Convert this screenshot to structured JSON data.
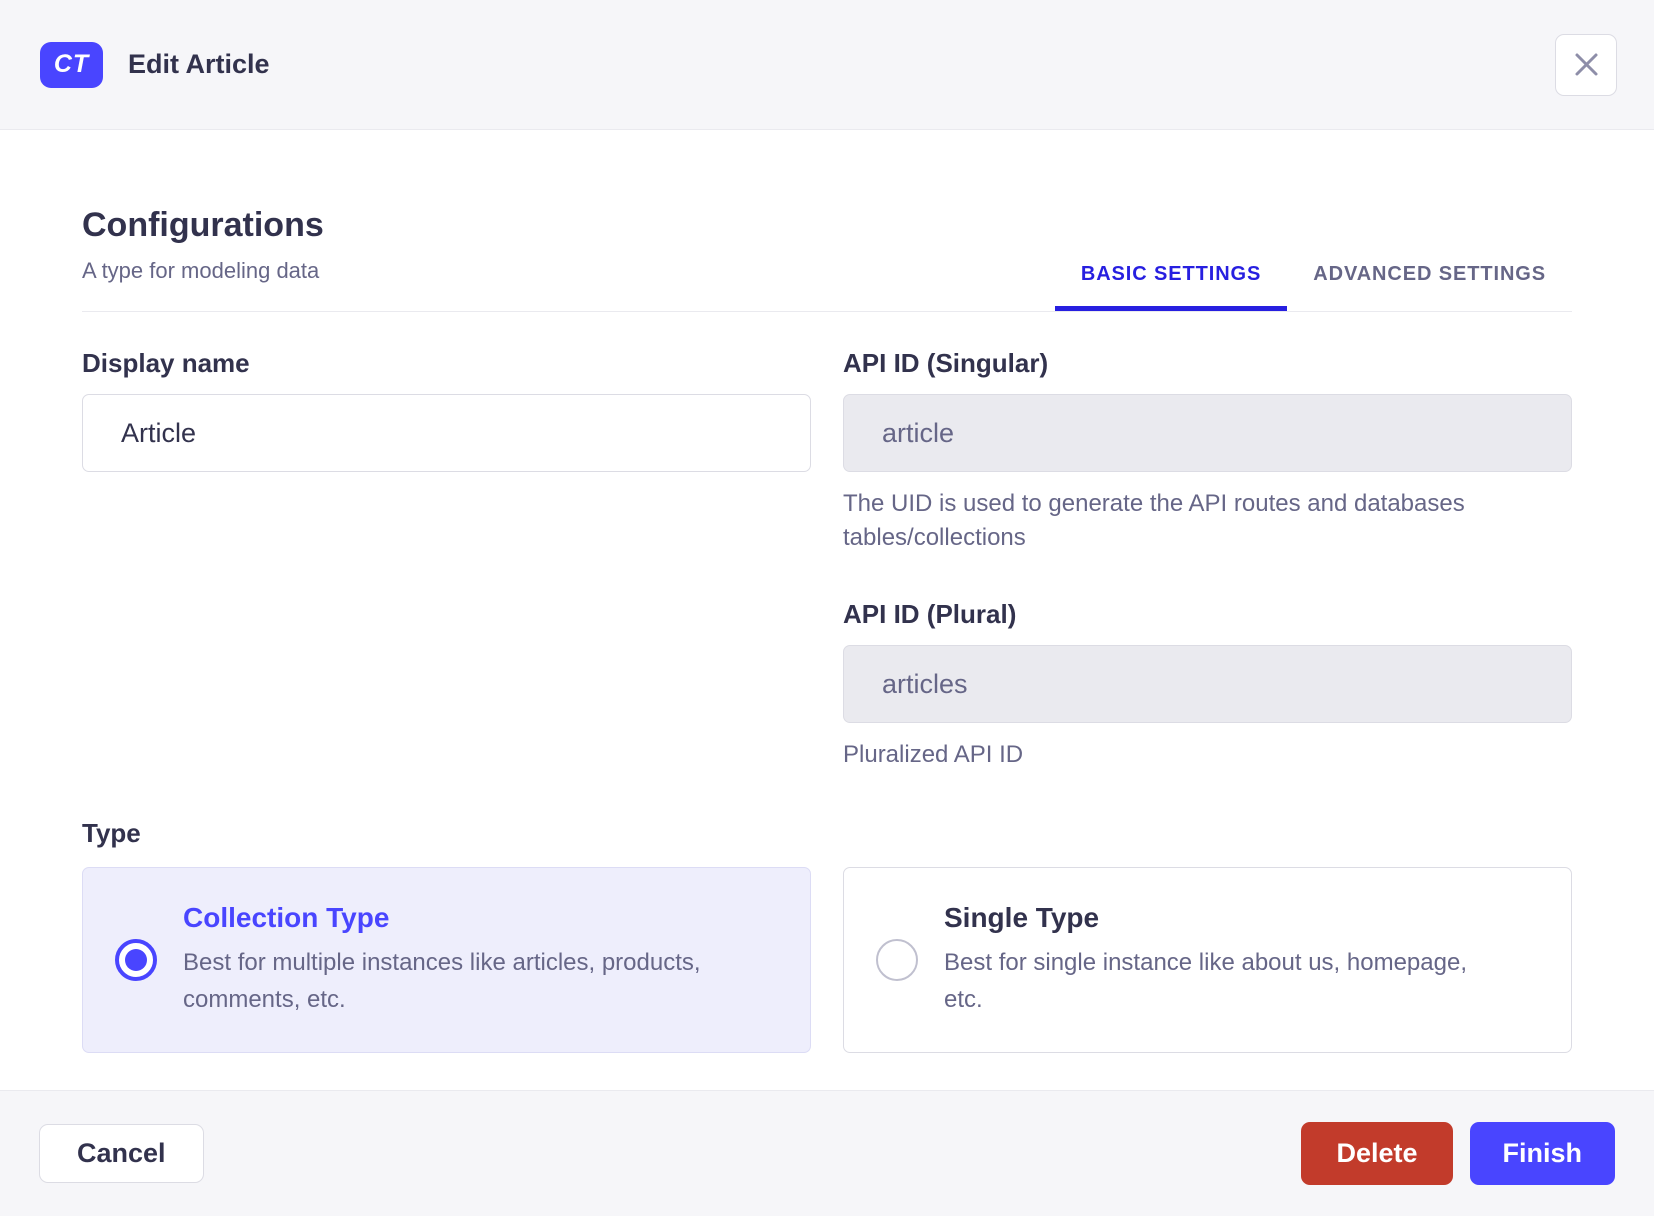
{
  "header": {
    "badge": "CT",
    "title": "Edit Article"
  },
  "icons": {
    "close": "x-mark"
  },
  "section": {
    "title": "Configurations",
    "subtitle": "A type for modeling data"
  },
  "tabs": [
    {
      "label": "BASIC SETTINGS",
      "active": true
    },
    {
      "label": "ADVANCED SETTINGS",
      "active": false
    }
  ],
  "fields": {
    "display_name": {
      "label": "Display name",
      "value": "Article"
    },
    "api_id_singular": {
      "label": "API ID (Singular)",
      "value": "article",
      "hint": "The UID is used to generate the API routes and databases tables/collections"
    },
    "api_id_plural": {
      "label": "API ID (Plural)",
      "value": "articles",
      "hint": "Pluralized API ID"
    }
  },
  "type": {
    "label": "Type",
    "options": [
      {
        "title": "Collection Type",
        "description": "Best for multiple instances like articles, products, comments, etc.",
        "selected": true
      },
      {
        "title": "Single Type",
        "description": "Best for single instance like about us, homepage, etc.",
        "selected": false
      }
    ]
  },
  "footer": {
    "cancel": "Cancel",
    "delete": "Delete",
    "finish": "Finish"
  },
  "colors": {
    "primary": "#4945ff",
    "tab_active": "#271fe0",
    "danger": "#c23b2b",
    "text_dark": "#32324d",
    "text_muted": "#666687",
    "surface": "#f6f6f9"
  }
}
